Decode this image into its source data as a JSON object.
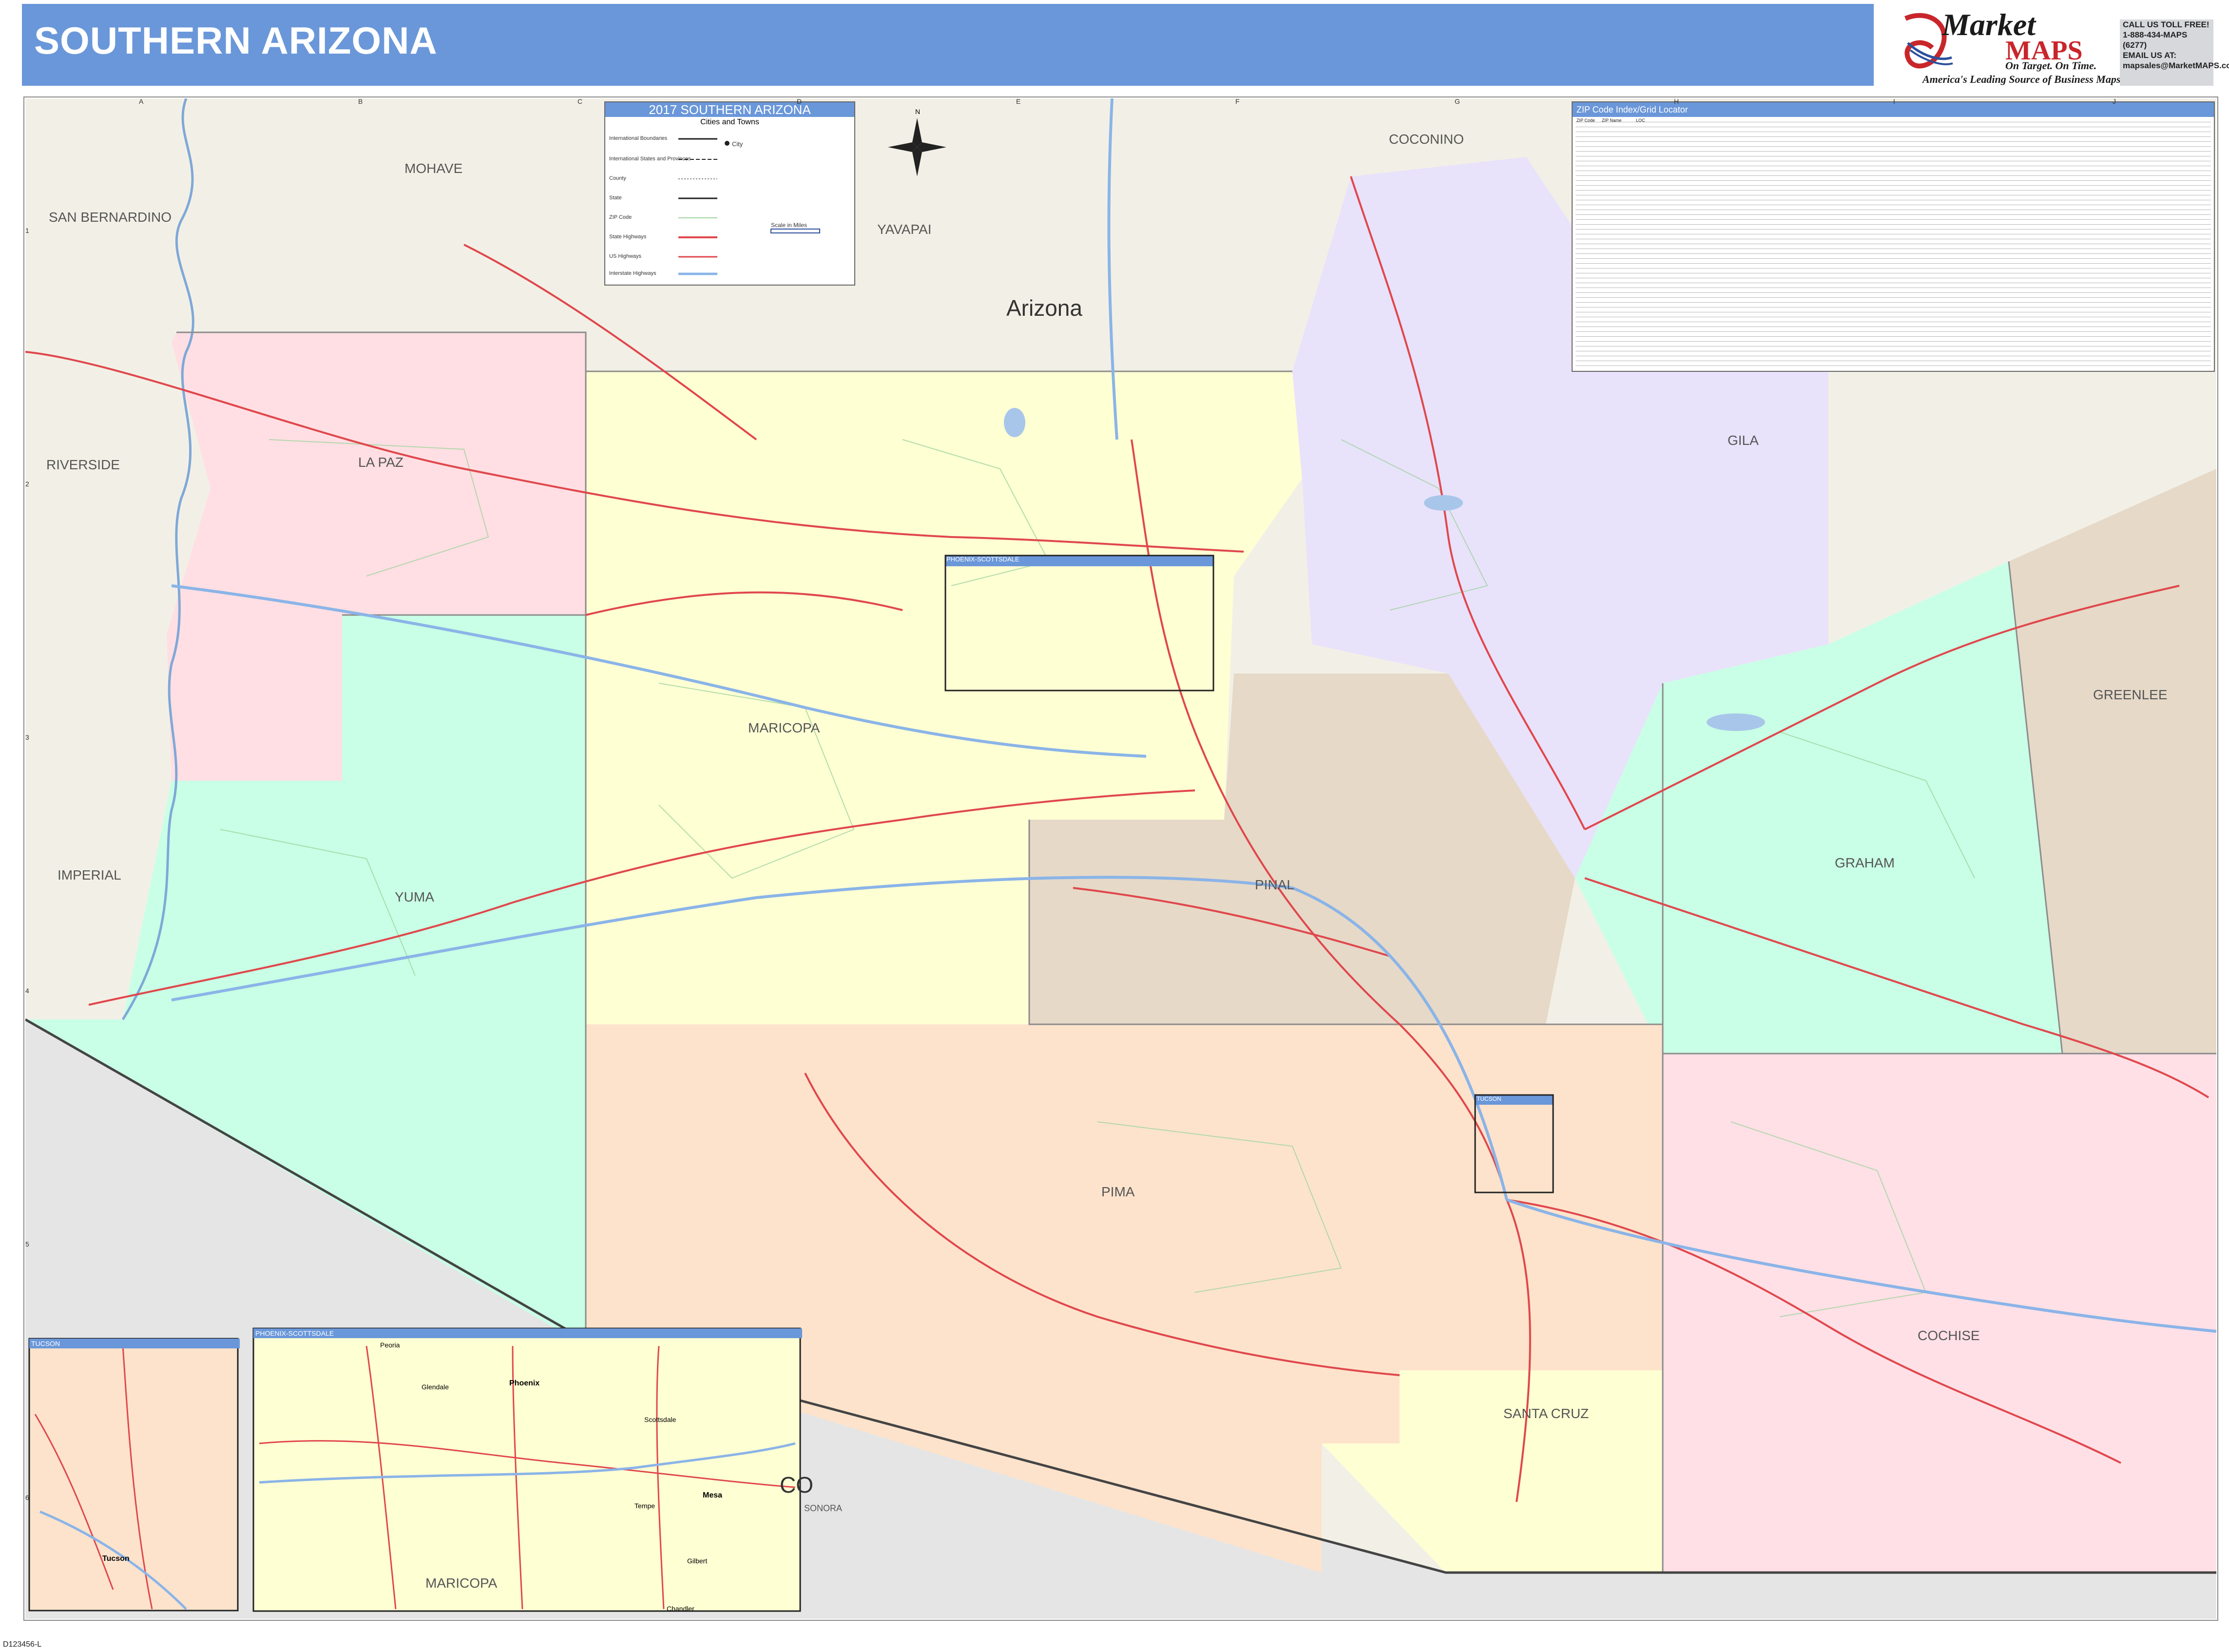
{
  "header": {
    "title": "SOUTHERN ARIZONA",
    "brand_market": "Market",
    "brand_maps": "MAPS",
    "brand_tagline": "On Target. On Time.",
    "brand_sub": "America's Leading Source of Business Maps",
    "contact_lines": [
      "CALL US TOLL FREE!",
      "1-888-434-MAPS (6277)",
      "EMAIL US AT:",
      "mapsales@MarketMAPS.com"
    ]
  },
  "colors": {
    "header_blue": "#6a97d9",
    "maricopa": "#ffffd4",
    "pinal": "#e6d9c8",
    "pima": "#fde3cc",
    "yuma": "#c9ffe6",
    "la_paz": "#ffdfe3",
    "gila": "#e9e2fb",
    "graham": "#c9ffe6",
    "cochise": "#ffe0e6",
    "greenlee": "#e6d9c8",
    "santa_cruz": "#ffffd4",
    "outside": "#f2f0e6",
    "mexico": "#e5e5e5",
    "roads": "#e0474c",
    "interstate": "#8ab4e8",
    "zip_lines": "#9fd59f"
  },
  "grid": {
    "columns": [
      "A",
      "B",
      "C",
      "D",
      "E",
      "F",
      "G",
      "H",
      "I",
      "J"
    ],
    "rows": [
      "1",
      "2",
      "3",
      "4",
      "5",
      "6"
    ]
  },
  "labels": {
    "state": "Arizona",
    "counties": {
      "mohave": "MOHAVE",
      "san_bernardino": "SAN BERNARDINO",
      "coconino": "COCONINO",
      "yavapai": "YAVAPAI",
      "riverside": "RIVERSIDE",
      "la_paz": "LA PAZ",
      "gila": "GILA",
      "greenlee": "GREENLEE",
      "maricopa": "MARICOPA",
      "imperial": "IMPERIAL",
      "yuma": "YUMA",
      "pinal": "PINAL",
      "graham": "GRAHAM",
      "pima": "PIMA",
      "cochise": "COCHISE",
      "santa_cruz": "SANTA CRUZ",
      "sonora": "SONORA",
      "mexico_fragment": "CO"
    }
  },
  "legend": {
    "title": "2017 SOUTHERN ARIZONA",
    "subtitle": "Cities and Towns",
    "items": [
      "International Boundaries",
      "International States and Provinces",
      "County",
      "State",
      "ZIP Code",
      "State Highways",
      "US Highways",
      "Interstate Highways"
    ],
    "city_label": "City",
    "scale_label": "Scale in Miles"
  },
  "insets": {
    "phoenix_box": "PHOENIX-SCOTTSDALE",
    "tucson_box": "TUCSON",
    "phoenix_inset_title": "PHOENIX-SCOTTSDALE",
    "tucson_inset_title": "TUCSON",
    "phoenix_cities": [
      "Peoria",
      "Glendale",
      "Phoenix",
      "Scottsdale",
      "Tempe",
      "Mesa",
      "Gilbert",
      "Chandler"
    ],
    "phoenix_county": "MARICOPA",
    "tucson_city": "Tucson"
  },
  "zip_index": {
    "title": "ZIP Code Index/Grid Locator",
    "column_headers": [
      "ZIP Code",
      "ZIP Name",
      "LOC"
    ]
  },
  "footer": {
    "code": "D123456-L"
  }
}
